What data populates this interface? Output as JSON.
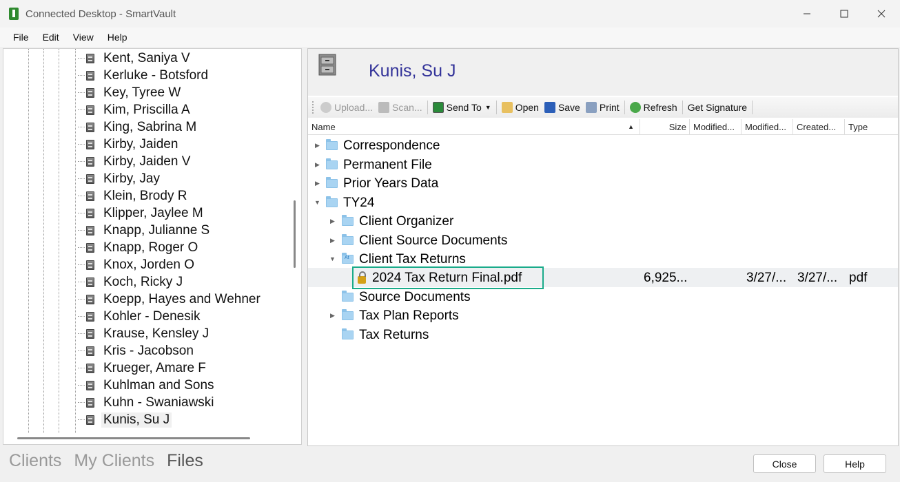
{
  "window": {
    "title": "Connected Desktop - SmartVault"
  },
  "menu": [
    "File",
    "Edit",
    "View",
    "Help"
  ],
  "tree": {
    "items": [
      "Kent, Saniya V",
      "Kerluke - Botsford",
      "Key, Tyree W",
      "Kim, Priscilla A",
      "King, Sabrina M",
      "Kirby, Jaiden",
      "Kirby, Jaiden V",
      "Kirby, Jay",
      "Klein, Brody R",
      "Klipper, Jaylee M",
      "Knapp, Julianne S",
      "Knapp, Roger O",
      "Knox, Jorden O",
      "Koch, Ricky J",
      "Koepp, Hayes and Wehner",
      "Kohler - Denesik",
      "Krause, Kensley J",
      "Kris - Jacobson",
      "Krueger, Amare F",
      "Kuhlman and Sons",
      "Kuhn - Swaniawski",
      "Kunis, Su J"
    ],
    "selected": "Kunis, Su J"
  },
  "client": {
    "name": "Kunis, Su J"
  },
  "toolbar": {
    "upload": "Upload...",
    "scan": "Scan...",
    "send_to": "Send To",
    "open": "Open",
    "save": "Save",
    "print": "Print",
    "refresh": "Refresh",
    "get_signature": "Get Signature"
  },
  "columns": {
    "name": "Name",
    "size": "Size",
    "modified1": "Modified...",
    "modified2": "Modified...",
    "created": "Created...",
    "type": "Type"
  },
  "files": {
    "correspondence": "Correspondence",
    "permanent": "Permanent File",
    "prior": "Prior Years Data",
    "ty24": "TY24",
    "organizer": "Client Organizer",
    "source_docs": "Client Source Documents",
    "tax_returns_folder": "Client Tax Returns",
    "pdf": {
      "name": "2024 Tax Return Final.pdf",
      "size": "6,925...",
      "modified": "3/27/...",
      "created": "3/27/...",
      "type": "pdf"
    },
    "source_documents": "Source Documents",
    "tax_plan": "Tax Plan Reports",
    "tax_returns": "Tax Returns"
  },
  "bottom_tabs": {
    "clients": "Clients",
    "my_clients": "My Clients",
    "files": "Files"
  },
  "buttons": {
    "close": "Close",
    "help": "Help"
  },
  "colors": {
    "title_blue": "#333399",
    "focus_green": "#1aab8a",
    "folder": "#a9d4f2"
  }
}
